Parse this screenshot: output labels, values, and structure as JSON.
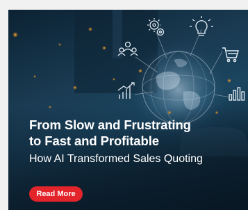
{
  "banner": {
    "headline_line1": "From Slow and Frustrating",
    "headline_line2": "to Fast and Profitable",
    "subheadline": "How AI Transformed Sales Quoting",
    "cta_label": "Read More"
  },
  "colors": {
    "cta": "#e3242b",
    "background": "#1a3b52",
    "text": "#ffffff",
    "icon_stroke": "#e8f1f8"
  },
  "icons": [
    "gears-icon",
    "lightbulb-icon",
    "team-icon",
    "shopping-cart-icon",
    "growth-chart-icon",
    "bar-chart-icon",
    "globe-icon"
  ]
}
